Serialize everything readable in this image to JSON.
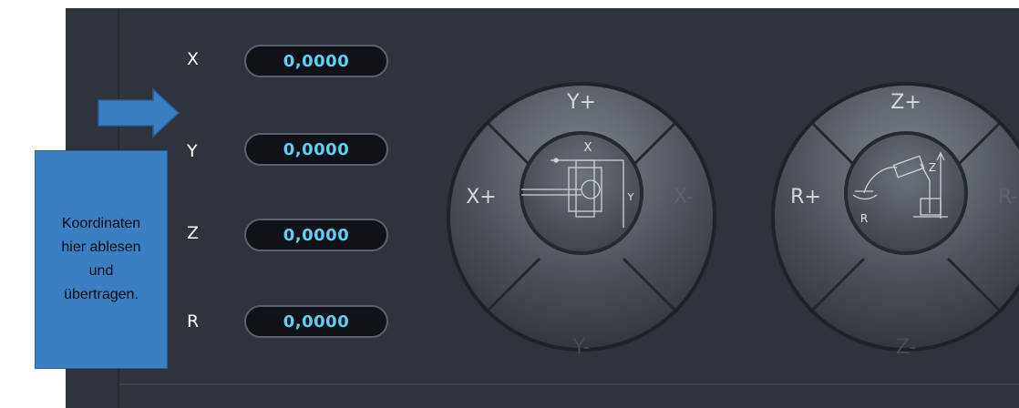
{
  "coordinates": [
    {
      "label": "X",
      "value": "0,0000"
    },
    {
      "label": "Y",
      "value": "0,0000"
    },
    {
      "label": "Z",
      "value": "0,0000"
    },
    {
      "label": "R",
      "value": "0,0000"
    }
  ],
  "callout": {
    "text": "Koordinaten\nhier ablesen\nund\nübertragen."
  },
  "jog_xy": {
    "top": "Y+",
    "left": "X+",
    "right": "X-",
    "bottom": "Y-",
    "center_axis_top": "X",
    "center_axis_right": "Y"
  },
  "jog_zr": {
    "top": "Z+",
    "left": "R+",
    "right": "R-",
    "bottom": "Z-",
    "center_axis_z": "Z",
    "center_axis_r": "R"
  },
  "colors": {
    "panel": "#2f333c",
    "readout_text": "#5fd0f2",
    "callout": "#3a7ec4"
  }
}
